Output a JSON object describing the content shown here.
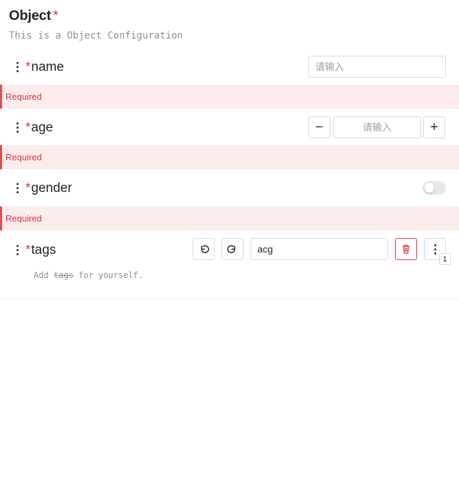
{
  "header": {
    "title": "Object",
    "required_mark": "*",
    "description": "This is a Object Configuration"
  },
  "fields": {
    "name": {
      "label": "name",
      "required_mark": "*",
      "placeholder": "请输入",
      "error": "Required"
    },
    "age": {
      "label": "age",
      "required_mark": "*",
      "placeholder": "请输入",
      "decrement_glyph": "−",
      "increment_glyph": "+",
      "error": "Required"
    },
    "gender": {
      "label": "gender",
      "required_mark": "*",
      "checked": false,
      "error": "Required"
    },
    "tags": {
      "label": "tags",
      "required_mark": "*",
      "value": "acg",
      "hint_prefix": "Add",
      "hint_struck": "tags",
      "hint_suffix": "for yourself.",
      "more_badge": "1"
    }
  },
  "colors": {
    "required": "#d9363e",
    "error_bg": "#fdecec",
    "error_bar": "#e34c4c"
  },
  "icons": [
    "drag-handle-icon",
    "undo-icon",
    "redo-icon",
    "trash-icon",
    "more-vertical-icon"
  ]
}
